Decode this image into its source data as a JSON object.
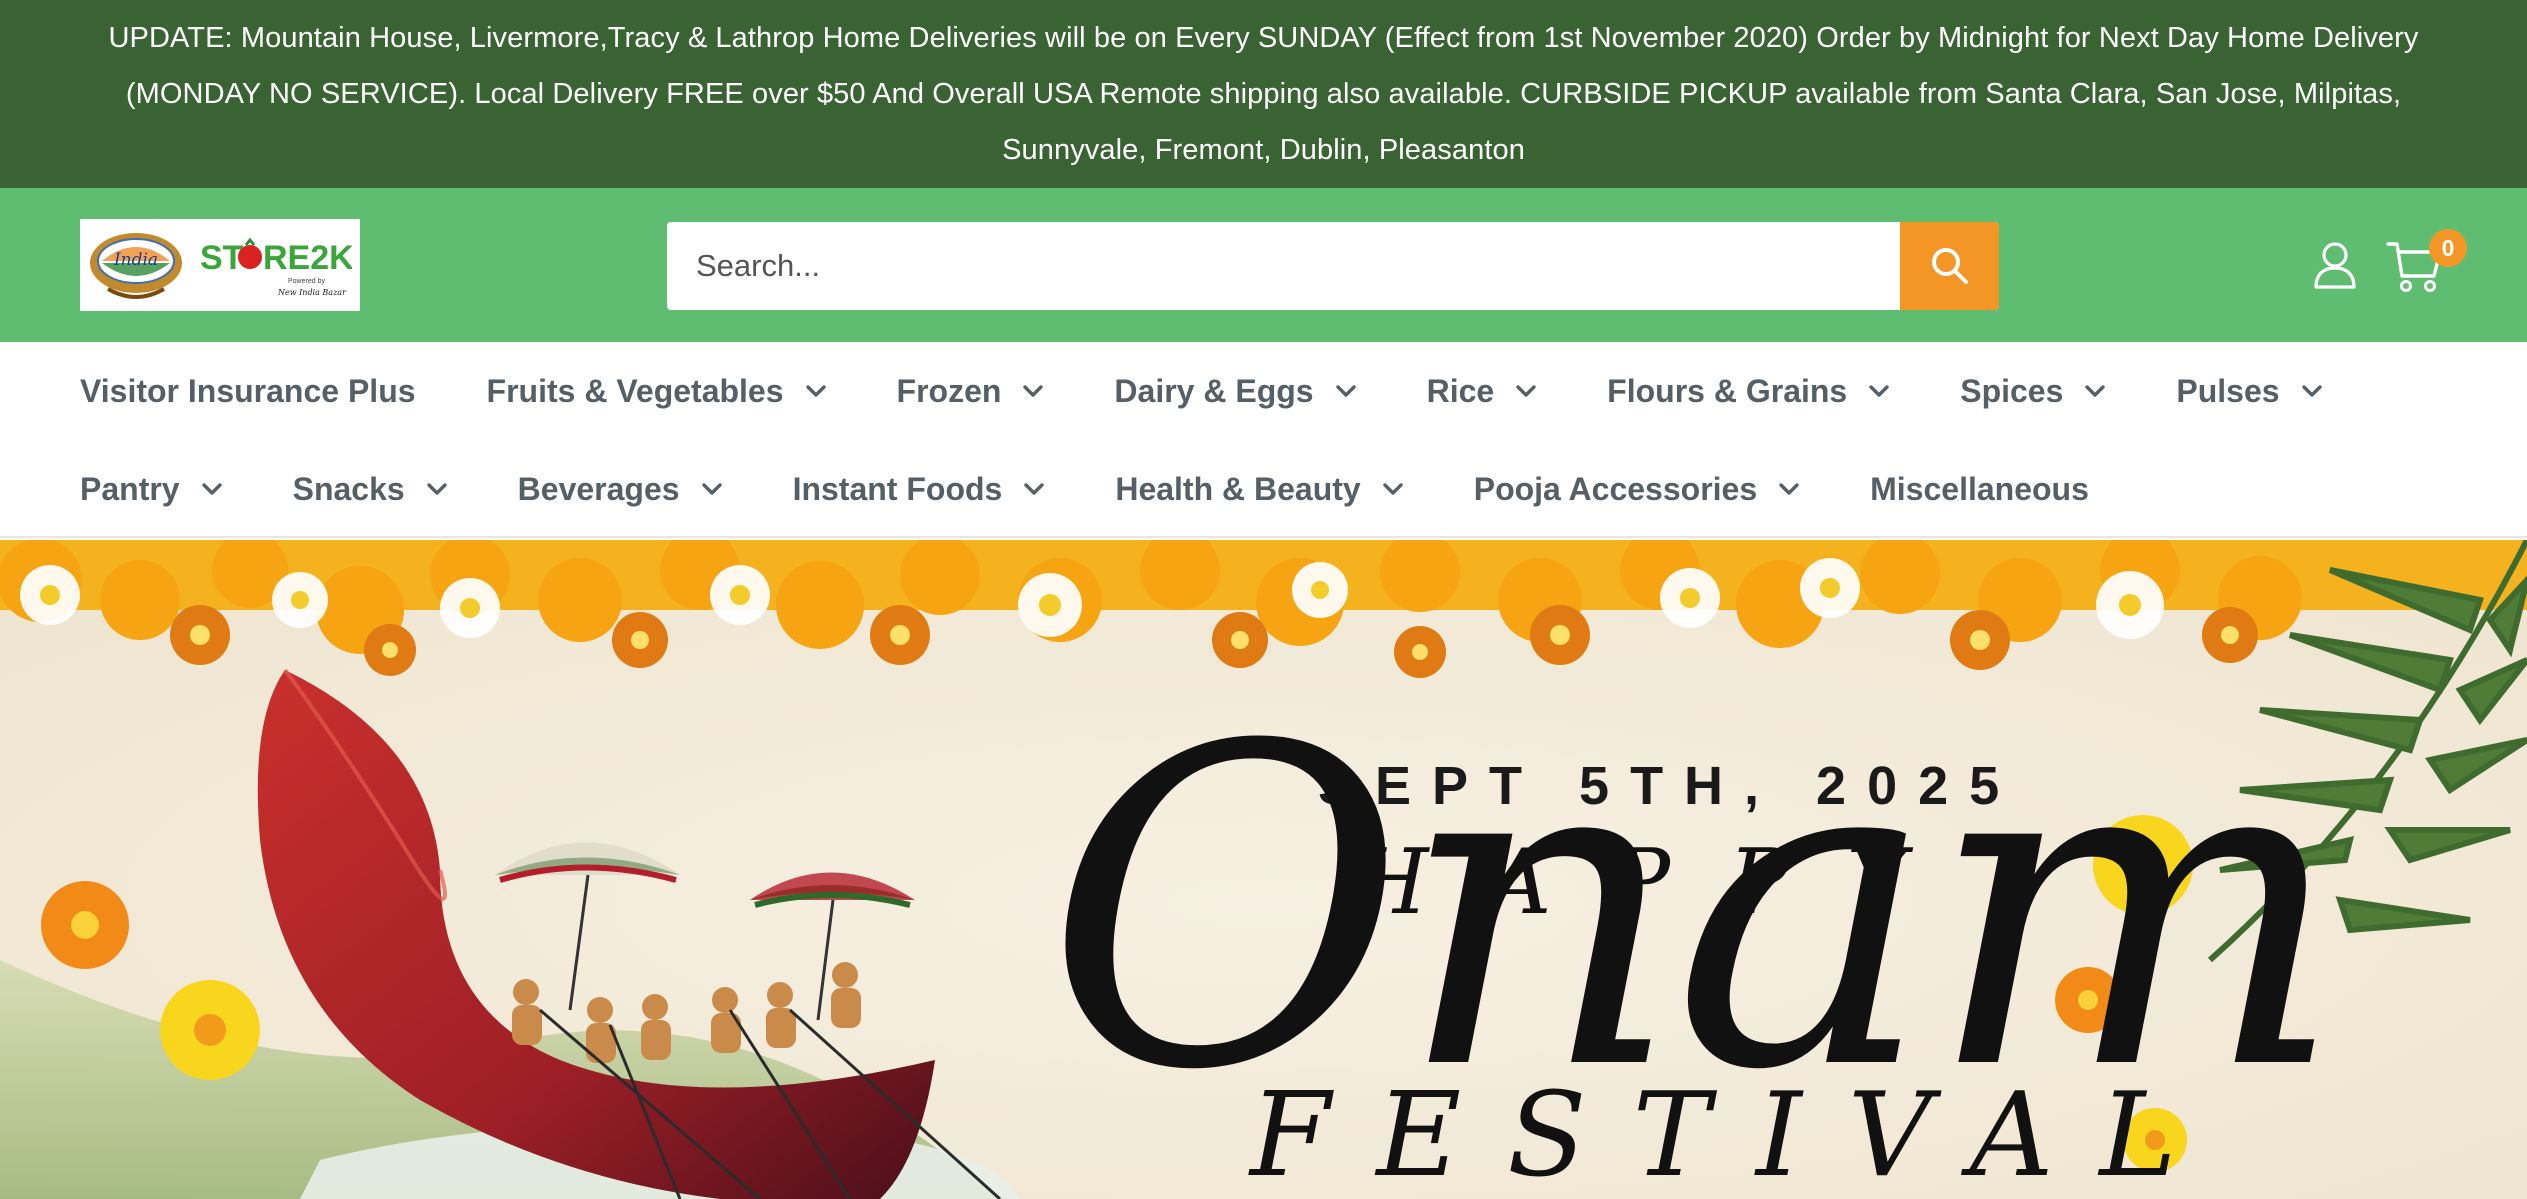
{
  "announcement": {
    "text": "UPDATE: Mountain House, Livermore,Tracy & Lathrop Home Deliveries will be on Every SUNDAY (Effect from 1st November 2020) Order by Midnight for Next Day Home Delivery (MONDAY NO SERVICE). Local Delivery FREE over $50 And Overall USA Remote shipping also available. CURBSIDE PICKUP available from Santa Clara, San Jose, Milpitas, Sunnyvale, Fremont, Dublin, Pleasanton"
  },
  "header": {
    "logo": {
      "left_text": "New India Bazar",
      "brand_text": "STORE2K",
      "tagline": "Powered by",
      "tagline_brand": "New India Bazar"
    },
    "search": {
      "placeholder": "Search...",
      "value": ""
    },
    "cart_count": "0",
    "icons": [
      "search-icon",
      "account-icon",
      "cart-icon"
    ]
  },
  "nav": {
    "row1": [
      {
        "label": "Visitor Insurance Plus",
        "has_dropdown": false
      },
      {
        "label": "Fruits & Vegetables",
        "has_dropdown": true
      },
      {
        "label": "Frozen",
        "has_dropdown": true
      },
      {
        "label": "Dairy & Eggs",
        "has_dropdown": true
      },
      {
        "label": "Rice",
        "has_dropdown": true
      },
      {
        "label": "Flours & Grains",
        "has_dropdown": true
      },
      {
        "label": "Spices",
        "has_dropdown": true
      },
      {
        "label": "Pulses",
        "has_dropdown": true
      }
    ],
    "row2": [
      {
        "label": "Pantry",
        "has_dropdown": true
      },
      {
        "label": "Snacks",
        "has_dropdown": true
      },
      {
        "label": "Beverages",
        "has_dropdown": true
      },
      {
        "label": "Instant Foods",
        "has_dropdown": true
      },
      {
        "label": "Health & Beauty",
        "has_dropdown": true
      },
      {
        "label": "Pooja Accessories",
        "has_dropdown": true
      },
      {
        "label": "Miscellaneous",
        "has_dropdown": false
      }
    ]
  },
  "hero": {
    "date": "SEPT 5TH, 2025",
    "happy": "HAPPY",
    "onam": "Onam",
    "festival": "FESTIVAL"
  },
  "colors": {
    "announcement_bg": "#3a6334",
    "header_bg": "#5fbd72",
    "accent": "#f39625",
    "nav_text": "#575f66",
    "hero_bg": "#f4ecdc"
  }
}
